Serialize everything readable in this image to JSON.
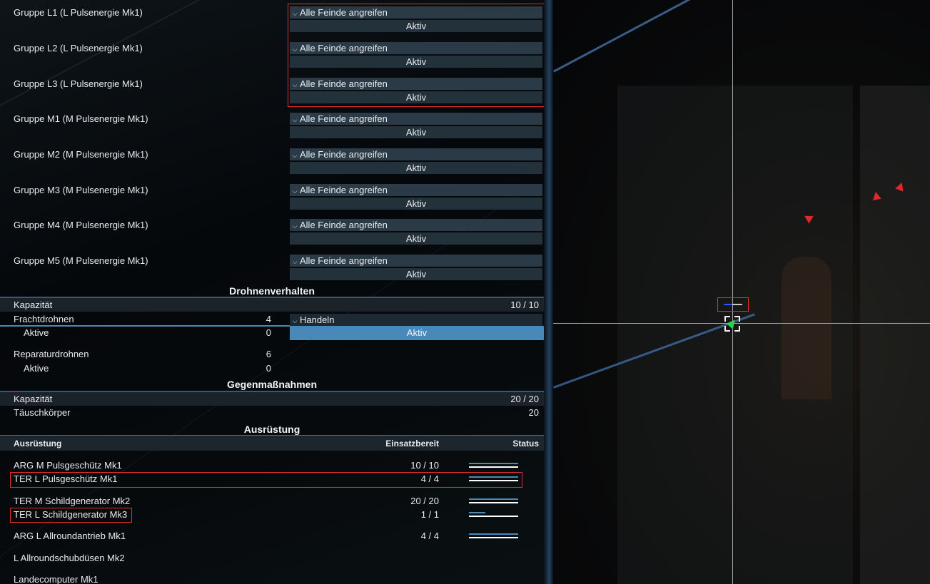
{
  "weapon_groups": [
    {
      "name": "Gruppe L1 (L Pulsenergie Mk1)",
      "mode": "Alle Feinde angreifen",
      "state": "Aktiv"
    },
    {
      "name": "Gruppe L2 (L Pulsenergie Mk1)",
      "mode": "Alle Feinde angreifen",
      "state": "Aktiv"
    },
    {
      "name": "Gruppe L3 (L Pulsenergie Mk1)",
      "mode": "Alle Feinde angreifen",
      "state": "Aktiv"
    },
    {
      "name": "Gruppe M1 (M Pulsenergie Mk1)",
      "mode": "Alle Feinde angreifen",
      "state": "Aktiv"
    },
    {
      "name": "Gruppe M2 (M Pulsenergie Mk1)",
      "mode": "Alle Feinde angreifen",
      "state": "Aktiv"
    },
    {
      "name": "Gruppe M3 (M Pulsenergie Mk1)",
      "mode": "Alle Feinde angreifen",
      "state": "Aktiv"
    },
    {
      "name": "Gruppe M4 (M Pulsenergie Mk1)",
      "mode": "Alle Feinde angreifen",
      "state": "Aktiv"
    },
    {
      "name": "Gruppe M5 (M Pulsenergie Mk1)",
      "mode": "Alle Feinde angreifen",
      "state": "Aktiv"
    }
  ],
  "drones": {
    "title": "Drohnenverhalten",
    "capacity_label": "Kapazität",
    "capacity_value": "10 / 10",
    "cargo_label": "Frachtdrohnen",
    "cargo_count": "4",
    "cargo_mode": "Handeln",
    "cargo_active_label": "Aktive",
    "cargo_active_count": "0",
    "cargo_active_button": "Aktiv",
    "repair_label": "Reparaturdrohnen",
    "repair_count": "6",
    "repair_active_label": "Aktive",
    "repair_active_count": "0"
  },
  "countermeasures": {
    "title": "Gegenmaßnahmen",
    "capacity_label": "Kapazität",
    "capacity_value": "20 / 20",
    "decoy_label": "Täuschkörper",
    "decoy_value": "20"
  },
  "equipment": {
    "title": "Ausrüstung",
    "col_name": "Ausrüstung",
    "col_ready": "Einsatzbereit",
    "col_status": "Status",
    "items": [
      {
        "name": "ARG M Pulsgeschütz Mk1",
        "ready": "10 / 10",
        "status_fraction": 1.0
      },
      {
        "name": "TER L Pulsgeschütz Mk1",
        "ready": "4 / 4",
        "status_fraction": 1.0
      },
      {
        "name": "TER M Schildgenerator Mk2",
        "ready": "20 / 20",
        "status_fraction": 1.0
      },
      {
        "name": "TER L Schildgenerator Mk3",
        "ready": "1 / 1",
        "status_fraction": 0.33
      },
      {
        "name": "ARG L Allroundantrieb Mk1",
        "ready": "4 / 4",
        "status_fraction": 1.0
      },
      {
        "name": "L Allroundschubdüsen Mk2",
        "ready": "",
        "status_fraction": null
      },
      {
        "name": "Landecomputer Mk1",
        "ready": "",
        "status_fraction": null
      }
    ]
  },
  "colors": {
    "accent": "#4a88b7",
    "highlight": "#e0302c",
    "player_ship": "#2bd14f",
    "enemy": "#e0282a"
  }
}
